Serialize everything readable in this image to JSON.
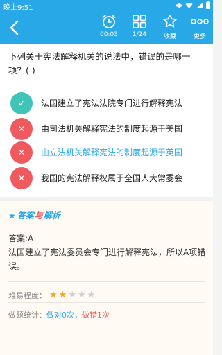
{
  "status_bar": {
    "time": "晚上9:51"
  },
  "nav": {
    "timer": "00:03",
    "progress": "1/24",
    "favorite": "收藏",
    "more": "更多"
  },
  "question": {
    "text": "下列关于宪法解释机关的说法中，错误的是哪一项？( )"
  },
  "options": [
    {
      "text": "法国建立了宪法法院专门进行解释宪法",
      "state": "correct",
      "icon": "check-icon"
    },
    {
      "text": "由司法机关解释宪法的制度起源于美国",
      "state": "wrong",
      "icon": "cross-icon"
    },
    {
      "text": "由立法机关解释宪法的制度起源于英国",
      "state": "wrong",
      "icon": "cross-icon"
    },
    {
      "text": "我国的宪法解释权属于全国人大常委会",
      "state": "wrong",
      "icon": "cross-icon"
    }
  ],
  "analysis": {
    "title_part1": "答案",
    "title_with": "与",
    "title_part2": "解析",
    "answer": "答案:A",
    "explanation": "法国建立了宪法委员会专门进行解释宪法，所以A项错误。",
    "difficulty_label": "难易程度：",
    "difficulty_level": 2,
    "difficulty_max": 5,
    "stats_label": "做题统计：",
    "stats_done": "做对0次",
    "stats_sep": "，",
    "stats_wrong": "做错1次"
  },
  "colors": {
    "accent": "#29a8e8",
    "correct": "#3fc5b7",
    "wrong": "#f05a5e",
    "star": "#f5a623"
  }
}
